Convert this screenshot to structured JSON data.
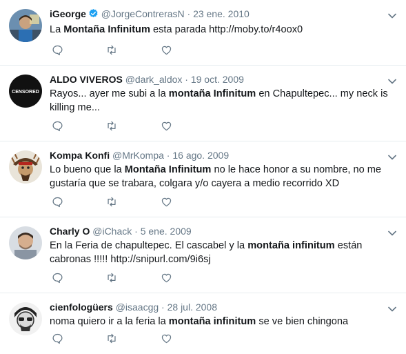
{
  "tweets": [
    {
      "name": "iGeorge",
      "verified": true,
      "handle": "@JorgeContrerasN",
      "date": "23 ene. 2010",
      "text": [
        {
          "t": "La "
        },
        {
          "t": "Montaña Infinitum",
          "b": true
        },
        {
          "t": " esta parada  http://moby.to/r4oox0"
        }
      ],
      "avatar": "avatar-photo"
    },
    {
      "name": "ALDO VIVEROS",
      "verified": false,
      "handle": "@dark_aldox",
      "date": "19 oct. 2009",
      "text": [
        {
          "t": "Rayos... ayer me subi a la "
        },
        {
          "t": "montaña Infinitum",
          "b": true
        },
        {
          "t": " en Chapultepec... my neck is killing me..."
        }
      ],
      "avatar": "censored-avatar",
      "avatar_text": "CENSORED"
    },
    {
      "name": "Kompa Konfi",
      "verified": false,
      "handle": "@MrKompa",
      "date": "16 ago. 2009",
      "text": [
        {
          "t": "Lo bueno que la "
        },
        {
          "t": "Montaña Infinitum",
          "b": true
        },
        {
          "t": " no le hace honor a su nombre, no me gustaría que se trabara, colgara y/o cayera a medio recorrido XD"
        }
      ],
      "avatar": "pirate-avatar"
    },
    {
      "name": "Charly O",
      "verified": false,
      "handle": "@iChack",
      "date": "5 ene. 2009",
      "text": [
        {
          "t": "En la Feria de chapultepec. El cascabel y la "
        },
        {
          "t": "montaña infinitum",
          "b": true
        },
        {
          "t": " están cabronas !!!!! http://snipurl.com/9i6sj"
        }
      ],
      "avatar": "portrait-avatar"
    },
    {
      "name": "cienfologüers",
      "verified": false,
      "handle": "@isaacgg",
      "date": "28 jul. 2008",
      "text": [
        {
          "t": "noma quiero ir a la feria la "
        },
        {
          "t": "montaña infinitum",
          "b": true
        },
        {
          "t": " se ve bien chingona"
        }
      ],
      "avatar": "sketch-avatar"
    }
  ],
  "separator": "·",
  "icons": {
    "reply": "reply-icon",
    "retweet": "retweet-icon",
    "like": "like-icon",
    "menu": "chevron-down-icon",
    "verified": "verified-badge-icon"
  },
  "colors": {
    "text": "#14171a",
    "muted": "#657786",
    "icon": "#657786",
    "verified": "#1da1f2",
    "divider": "#e6ecf0"
  }
}
